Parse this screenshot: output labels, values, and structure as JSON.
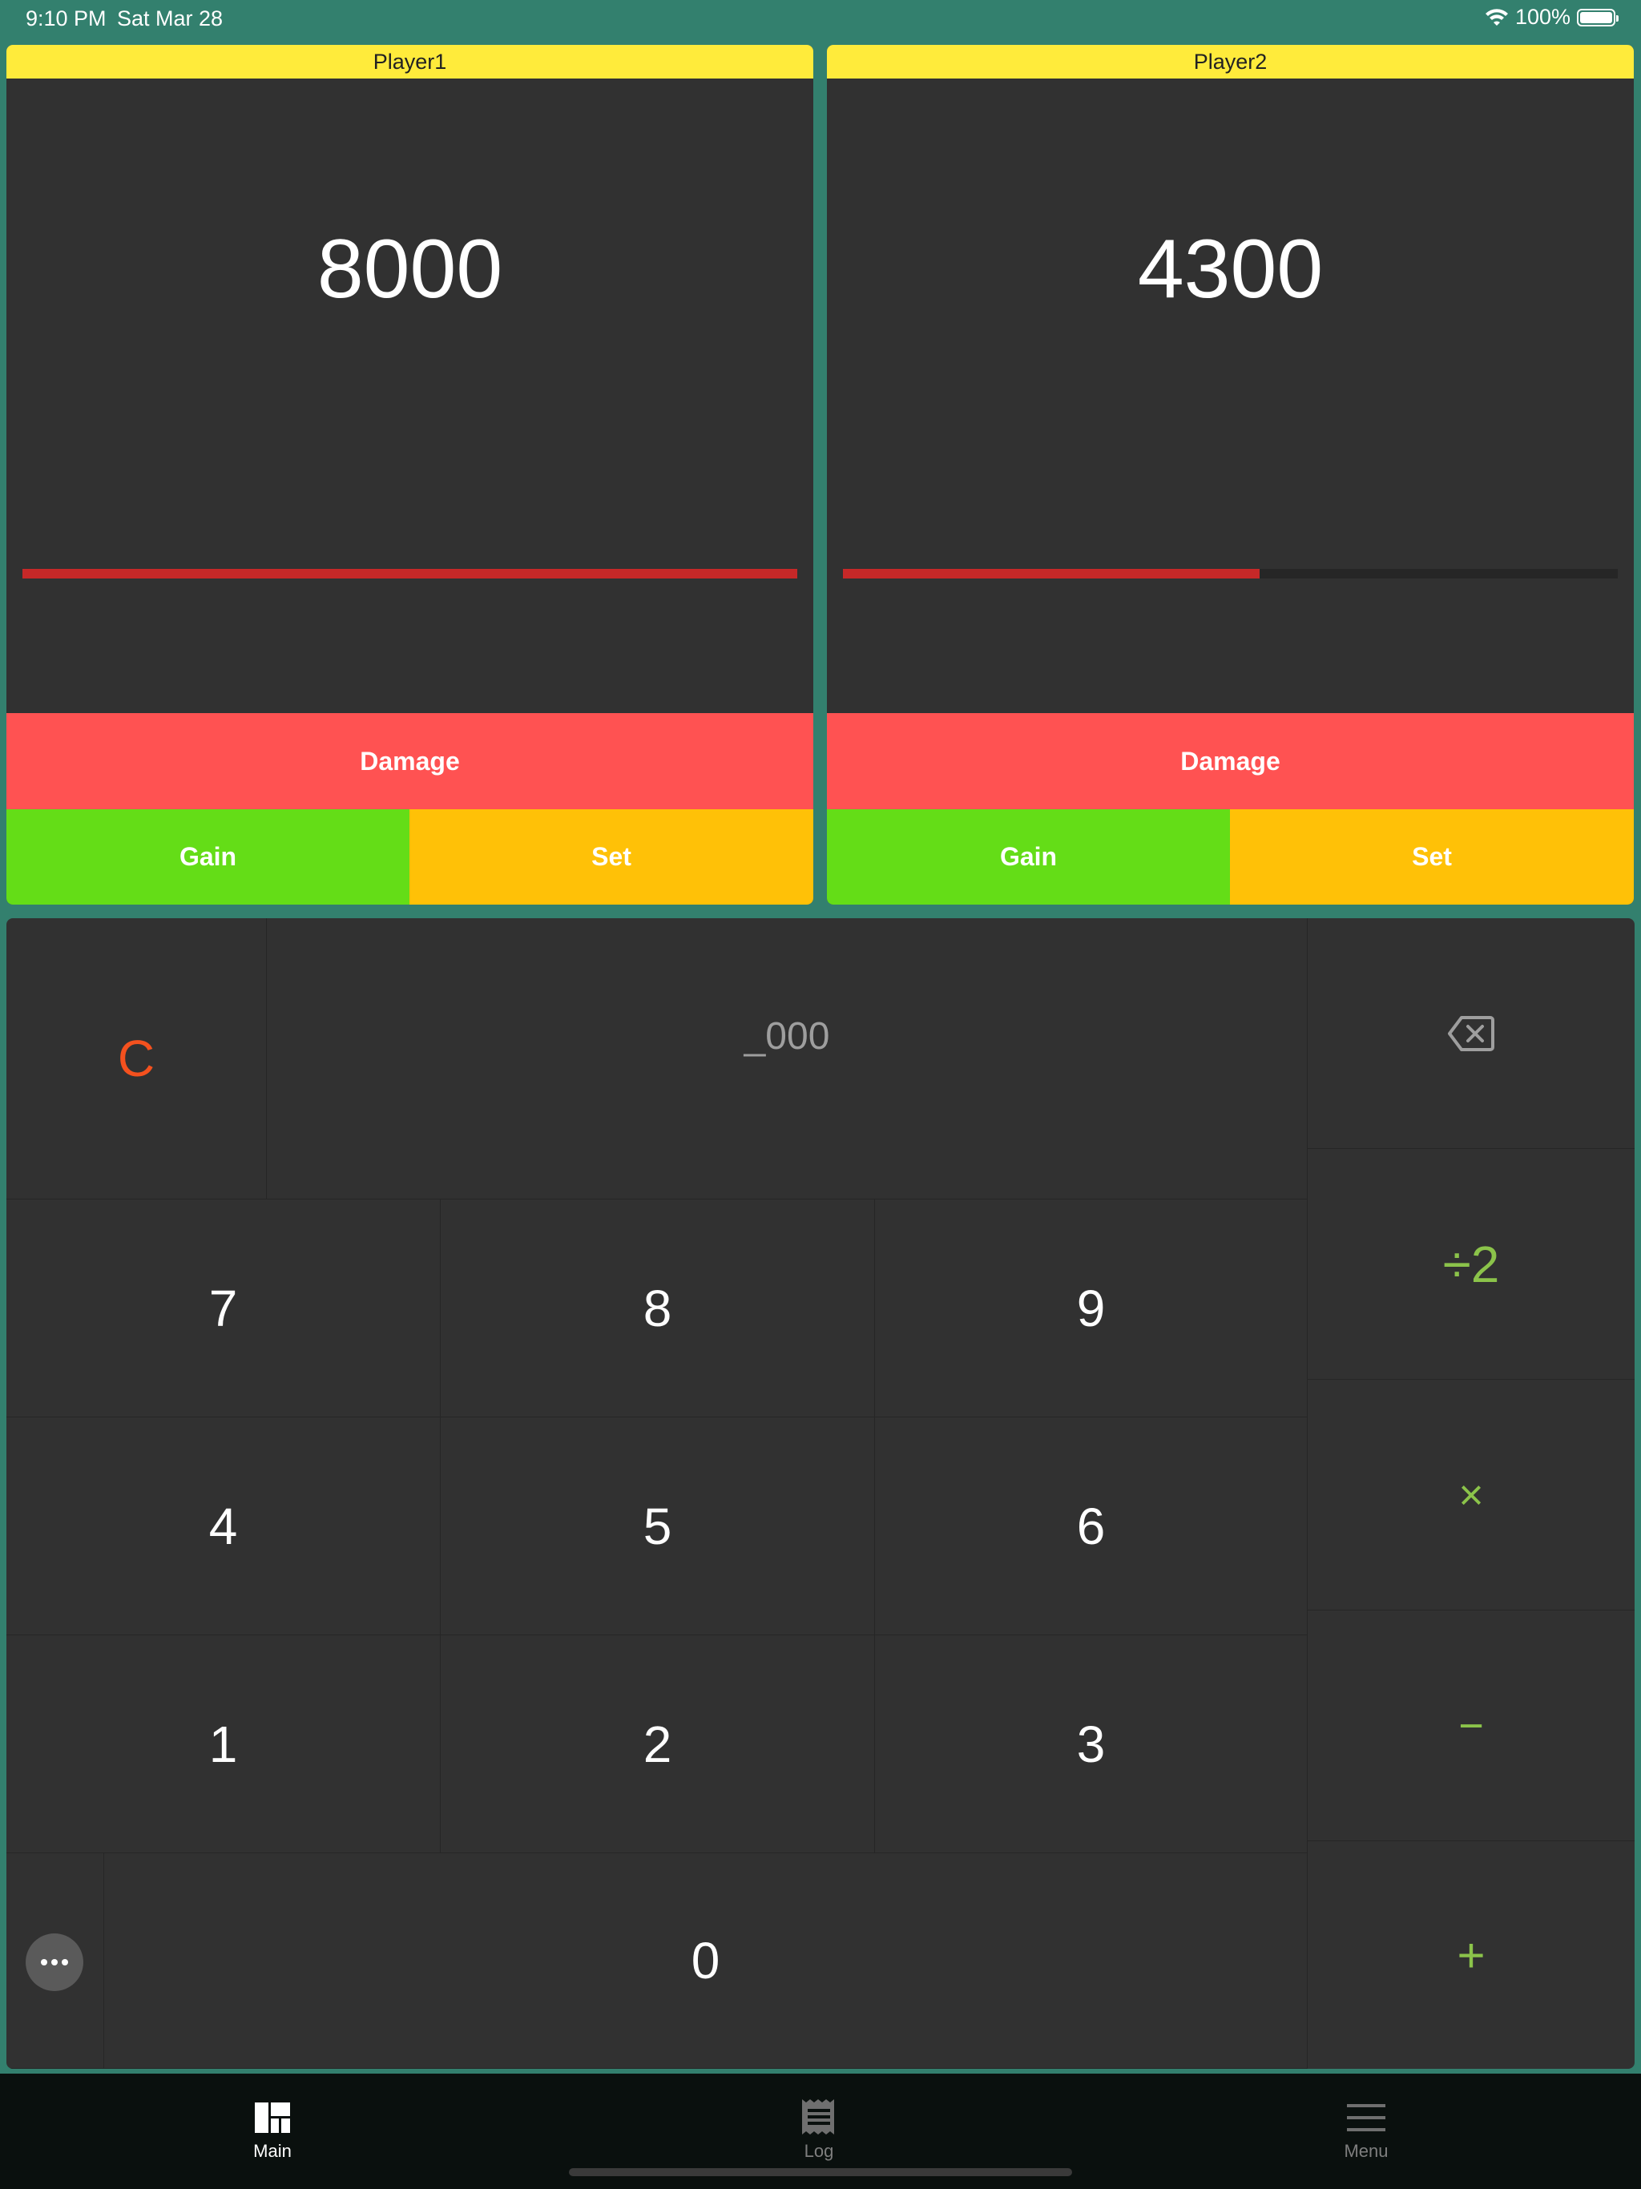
{
  "status": {
    "time": "9:10 PM",
    "date": "Sat Mar 28",
    "battery": "100%"
  },
  "players": [
    {
      "name": "Player1",
      "life": "8000",
      "life_fraction": 1.0,
      "damage_label": "Damage",
      "gain_label": "Gain",
      "set_label": "Set"
    },
    {
      "name": "Player2",
      "life": "4300",
      "life_fraction": 0.5375,
      "damage_label": "Damage",
      "gain_label": "Gain",
      "set_label": "Set"
    }
  ],
  "keypad": {
    "clear_label": "C",
    "display_value": "_000",
    "backspace_icon": "backspace-icon",
    "digits": [
      "7",
      "8",
      "9",
      "4",
      "5",
      "6",
      "1",
      "2",
      "3"
    ],
    "zero": "0",
    "ops": {
      "half": "÷2",
      "multiply": "×",
      "subtract": "−",
      "add": "+"
    },
    "more_icon": "ellipsis-icon"
  },
  "tabs": [
    {
      "label": "Main",
      "icon": "dashboard-icon",
      "active": true
    },
    {
      "label": "Log",
      "icon": "receipt-icon",
      "active": false
    },
    {
      "label": "Menu",
      "icon": "hamburger-icon",
      "active": false
    }
  ],
  "colors": {
    "background": "#33806e",
    "panel": "#313131",
    "title_bar": "#ffeb3b",
    "damage": "#ff5252",
    "gain": "#64dd17",
    "set": "#ffc107",
    "life_bar": "#c62828",
    "clear": "#f4511e",
    "operator": "#8bc34a"
  }
}
